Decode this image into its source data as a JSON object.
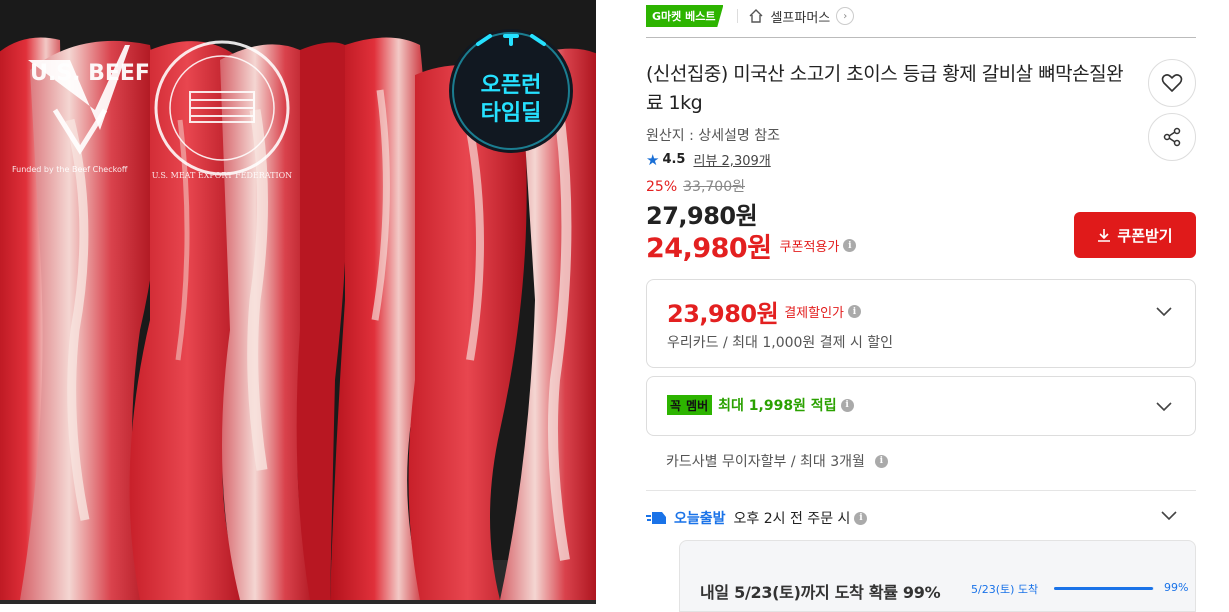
{
  "product_image": {
    "alt": "US beef boneless short ribs",
    "badge_left": "U.S. BEEF",
    "badge_left_small": "Funded by the Beef Checkoff",
    "badge_center": "U.S. MEAT EXPORT FEDERATION",
    "timedeal_line1": "오픈런",
    "timedeal_line2": "타임딜"
  },
  "breadcrumb": {
    "best_badge": "G마켓 베스트",
    "store_name": "셀프파머스",
    "store_chevron": "›"
  },
  "product": {
    "title": "(신선집중) 미국산 소고기 초이스 등급 황제 갈비살 뼈막손질완료 1kg",
    "origin": "원산지 : 상세설명 참조",
    "rating": "4.5",
    "reviews_label": "리뷰 2,309개",
    "discount_rate": "25%",
    "original_price": "33,700원",
    "sale_price": "27,980원",
    "coupon_price": "24,980원",
    "coupon_price_label": "쿠폰적용가",
    "coupon_button": "쿠폰받기"
  },
  "payment_discount": {
    "price": "23,980원",
    "label": "결제할인가",
    "detail": "우리카드 / 최대 1,000원 결제 시 할인"
  },
  "membership": {
    "logo_a": "꼭",
    "logo_b": "멤버",
    "text": "최대 1,998원 적립"
  },
  "installment": {
    "text": "카드사별 무이자할부 / 최대 3개월"
  },
  "shipping": {
    "brand": "오늘출발",
    "text": "오후 2시 전 주문 시",
    "arrival_title": "내일 5/23(토)까지 도착 확률 99%",
    "arrival_date": "5/23(토) 도착",
    "arrival_percent": "99%",
    "arrival_fraction": 0.99
  },
  "colors": {
    "accent_red": "#e32020",
    "best_green": "#2db400",
    "ship_blue": "#1a73e8"
  }
}
